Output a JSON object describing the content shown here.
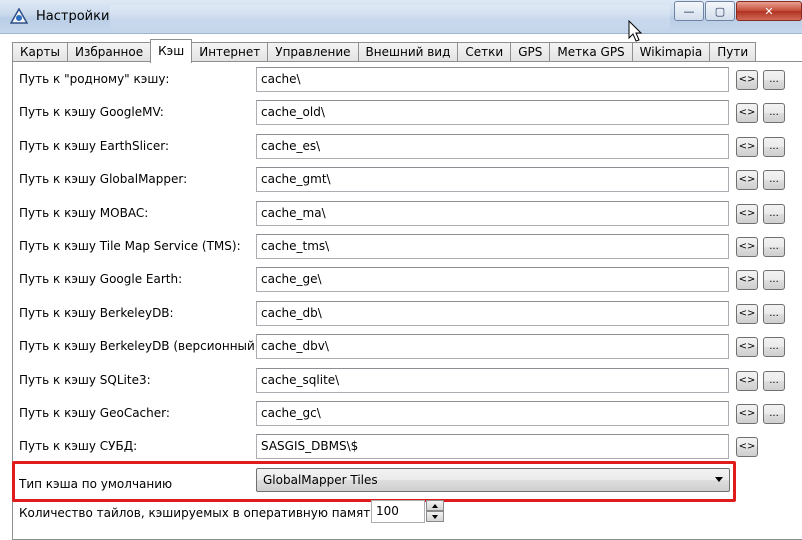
{
  "window": {
    "title": "Настройки",
    "min_glyph": "—",
    "max_glyph": "▢",
    "close_glyph": "✕"
  },
  "tabs": [
    "Карты",
    "Избранное",
    "Кэш",
    "Интернет",
    "Управление",
    "Внешний вид",
    "Сетки",
    "GPS",
    "Метка GPS",
    "Wikimapia",
    "Пути"
  ],
  "active_tab": "Кэш",
  "cache_paths": [
    {
      "label": "Путь к \"родному\" кэшу:",
      "value": "cache\\"
    },
    {
      "label": "Путь к кэшу GoogleMV:",
      "value": "cache_old\\"
    },
    {
      "label": "Путь к кэшу EarthSlicer:",
      "value": "cache_es\\"
    },
    {
      "label": "Путь к кэшу GlobalMapper:",
      "value": "cache_gmt\\"
    },
    {
      "label": "Путь к кэшу MOBAC:",
      "value": "cache_ma\\"
    },
    {
      "label": "Путь к кэшу Tile Map Service (TMS):",
      "value": "cache_tms\\"
    },
    {
      "label": "Путь к кэшу Google Earth:",
      "value": "cache_ge\\"
    },
    {
      "label": "Путь к кэшу BerkeleyDB:",
      "value": "cache_db\\"
    },
    {
      "label": "Путь к кэшу BerkeleyDB (версионный):",
      "value": "cache_dbv\\"
    },
    {
      "label": "Путь к кэшу SQLite3:",
      "value": "cache_sqlite\\"
    },
    {
      "label": "Путь к кэшу GeoCacher:",
      "value": "cache_gc\\"
    },
    {
      "label": "Путь к кэшу СУБД:",
      "value": "SASGIS_DBMS\\$"
    }
  ],
  "buttons": {
    "swap_label": "<>",
    "browse_label": "..."
  },
  "default_cache_type": {
    "label": "Тип кэша по умолчанию",
    "selected": "GlobalMapper Tiles"
  },
  "tiles_in_memory": {
    "label": "Количество тайлов, кэшируемых в оперативную память",
    "value": "100"
  },
  "colors": {
    "highlight": "#e01b1b",
    "titlebar": "#c9d9ec"
  }
}
